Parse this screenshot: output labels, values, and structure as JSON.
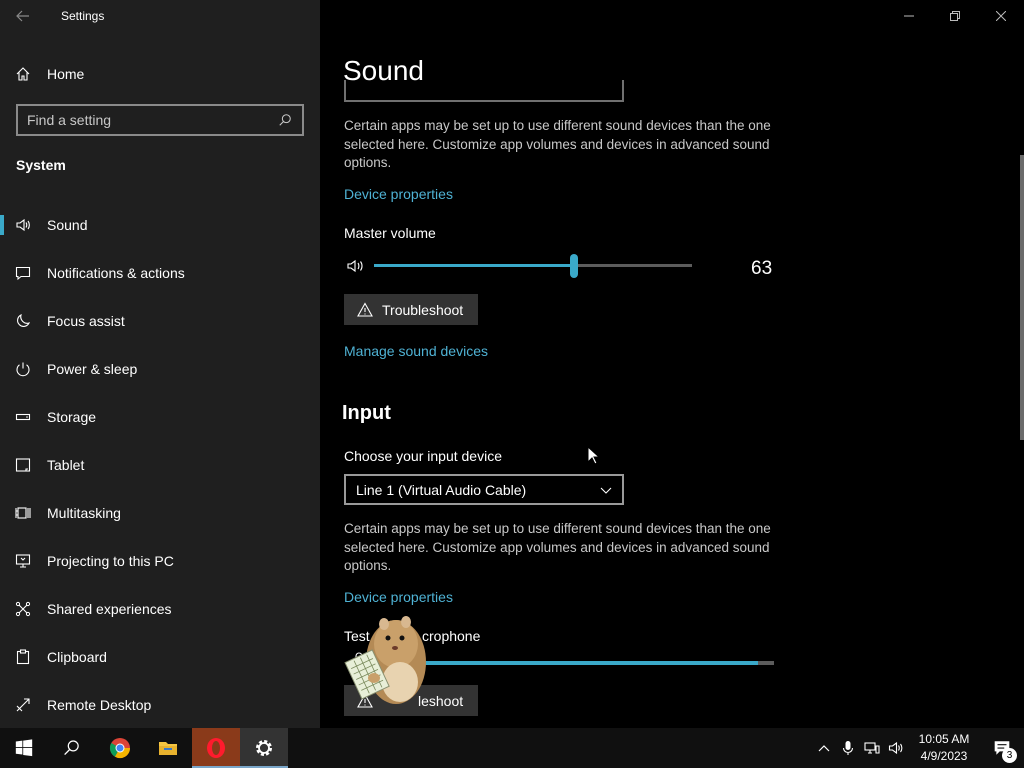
{
  "window": {
    "app_title": "Settings"
  },
  "sidebar": {
    "home_label": "Home",
    "search_placeholder": "Find a setting",
    "section": "System",
    "items": [
      {
        "label": "Sound",
        "icon": "speaker-icon",
        "active": true
      },
      {
        "label": "Notifications & actions",
        "icon": "message-icon"
      },
      {
        "label": "Focus assist",
        "icon": "moon-icon"
      },
      {
        "label": "Power & sleep",
        "icon": "power-icon"
      },
      {
        "label": "Storage",
        "icon": "storage-icon"
      },
      {
        "label": "Tablet",
        "icon": "tablet-icon"
      },
      {
        "label": "Multitasking",
        "icon": "multitasking-icon"
      },
      {
        "label": "Projecting to this PC",
        "icon": "project-icon"
      },
      {
        "label": "Shared experiences",
        "icon": "shared-icon"
      },
      {
        "label": "Clipboard",
        "icon": "clipboard-icon"
      },
      {
        "label": "Remote Desktop",
        "icon": "remote-icon"
      }
    ]
  },
  "main": {
    "page_title": "Sound",
    "output": {
      "description": "Certain apps may be set up to use different sound devices than the one selected here. Customize app volumes and devices in advanced sound options.",
      "device_properties_link": "Device properties",
      "master_volume_label": "Master volume",
      "volume_value": "63",
      "volume_level": 0.63,
      "troubleshoot_label": "Troubleshoot",
      "manage_link": "Manage sound devices"
    },
    "input": {
      "section_title": "Input",
      "choose_label": "Choose your input device",
      "selected_device": "Line 1 (Virtual Audio Cable)",
      "description": "Certain apps may be set up to use different sound devices than the one selected here. Customize app volumes and devices in advanced sound options.",
      "device_properties_link": "Device properties",
      "test_label_visible_start": "Test",
      "test_label_visible_end": "crophone",
      "mic_level": 0.96,
      "troubleshoot_label_visible": "leshoot"
    }
  },
  "taskbar": {
    "time": "10:05 AM",
    "date": "4/9/2023",
    "notification_count": "3",
    "colors": {
      "accent": "#3aa9c9",
      "link": "#4fb2d4"
    }
  }
}
